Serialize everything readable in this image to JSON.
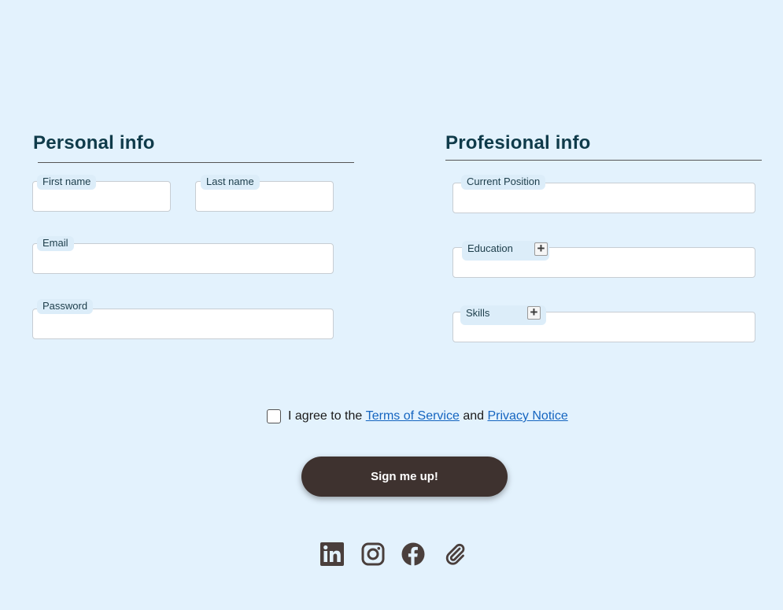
{
  "personal": {
    "title": "Personal info",
    "first_name_label": "First name",
    "last_name_label": "Last name",
    "email_label": "Email",
    "password_label": "Password"
  },
  "professional": {
    "title": "Profesional info",
    "position_label": "Current Position",
    "education_label": "Education",
    "skills_label": "Skills",
    "add_symbol": "+"
  },
  "consent": {
    "prefix": "I agree to the ",
    "terms_link": "Terms of Service",
    "conjunction": " and ",
    "privacy_link": "Privacy Notice"
  },
  "submit_label": "Sign me up!",
  "social_icons": [
    "linkedin-icon",
    "instagram-icon",
    "facebook-icon",
    "attachment-icon"
  ],
  "colors": {
    "background": "#e3f2fd",
    "title": "#0f3b4a",
    "button": "#3e322f",
    "link": "#1565c0",
    "icon": "#4a3f3c"
  }
}
